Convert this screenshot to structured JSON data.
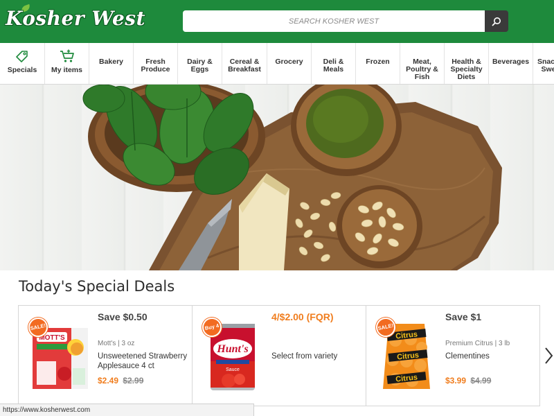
{
  "header": {
    "logo_text": "Kosher West",
    "search_placeholder": "SEARCH KOSHER WEST",
    "search_value": ""
  },
  "nav": {
    "items": [
      {
        "label": "Specials",
        "icon": "tag-icon"
      },
      {
        "label": "My items",
        "icon": "cart-plus-icon"
      },
      {
        "label": "Bakery"
      },
      {
        "label": "Fresh\nProduce"
      },
      {
        "label": "Dairy &\nEggs"
      },
      {
        "label": "Cereal &\nBreakfast"
      },
      {
        "label": "Grocery"
      },
      {
        "label": "Deli &\nMeals"
      },
      {
        "label": "Frozen"
      },
      {
        "label": "Meat,\nPoultry &\nFish"
      },
      {
        "label": "Health &\nSpecialty\nDiets"
      },
      {
        "label": "Beverages"
      },
      {
        "label": "Snacks &\nSweets"
      }
    ]
  },
  "hero": {
    "image": "basil-pesto-parmesan-pine-nuts-on-cutting-board"
  },
  "deals": {
    "title": "Today's Special Deals",
    "cards": [
      {
        "badge": "SALE!",
        "headline": "Save $0.50",
        "brand": "Mott's",
        "size": "3 oz",
        "meta": "Mott's | 3 oz",
        "name": "Unsweetened Strawberry Applesauce 4 ct",
        "price_now": "$2.49",
        "price_was": "$2.99",
        "image": "motts-applesauce-box"
      },
      {
        "badge": "Buy 4",
        "headline": "4/$2.00 (FQR)",
        "meta": "",
        "name": "Select from variety",
        "price_now": "",
        "price_was": "",
        "image": "hunts-tomato-sauce-can"
      },
      {
        "badge": "SALE!",
        "headline": "Save $1",
        "brand": "Premium Citrus",
        "size": "3 lb",
        "meta": "Premium Citrus | 3 lb",
        "name": "Clementines",
        "price_now": "$3.99",
        "price_was": "$4.99",
        "image": "citrus-clementines-bag"
      }
    ]
  },
  "status": {
    "url": "https://www.kosherwest.com"
  },
  "colors": {
    "brand_green": "#1e8a3c",
    "accent_orange": "#f07d1e",
    "badge_orange": "#f26b21",
    "search_button": "#3a3a3a"
  }
}
